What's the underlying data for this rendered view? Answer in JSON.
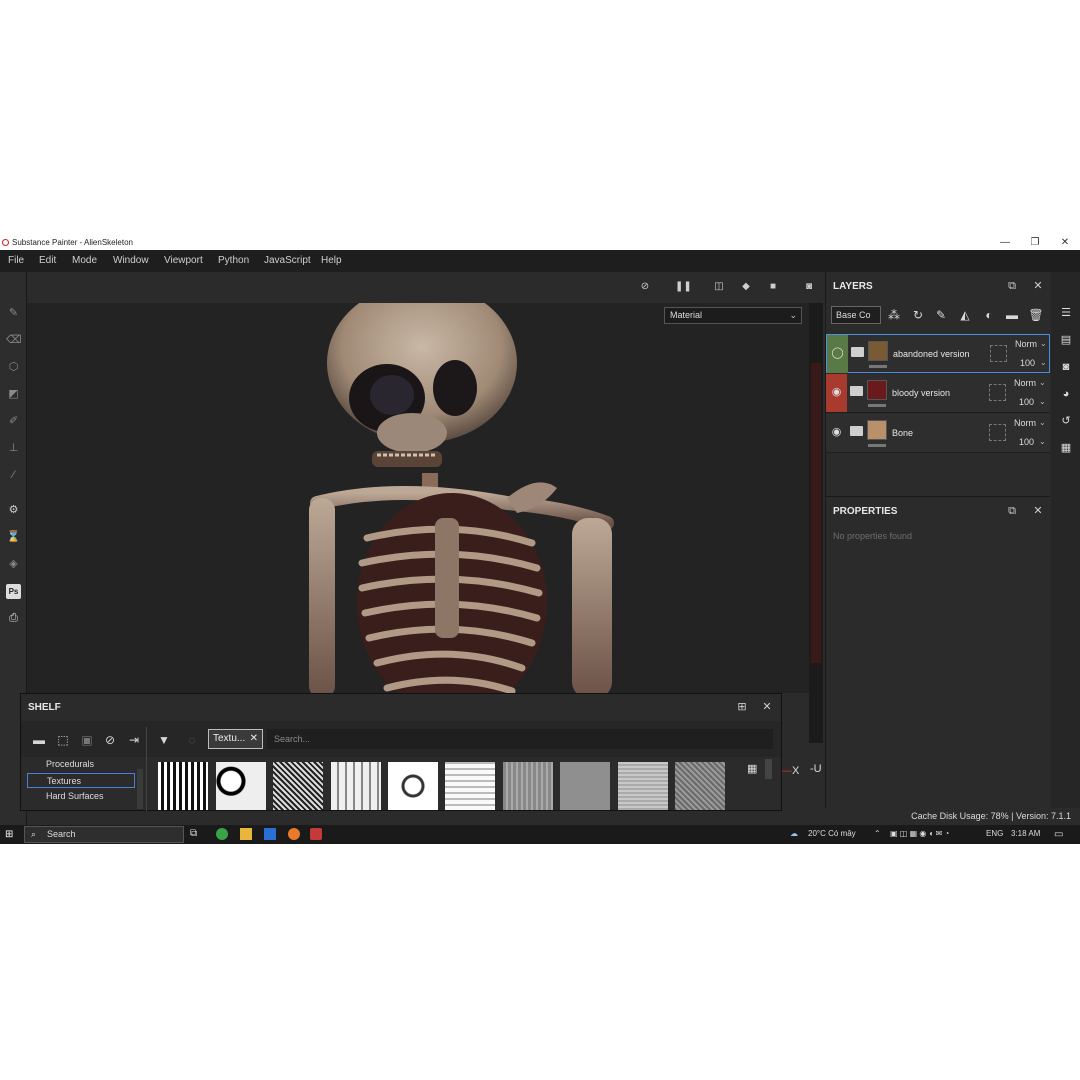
{
  "window": {
    "title": "Substance Painter - AlienSkeleton",
    "minimize": "—",
    "restore": "❐",
    "close": "✕"
  },
  "menu": [
    "File",
    "Edit",
    "Mode",
    "Window",
    "Viewport",
    "Python",
    "JavaScript",
    "Help"
  ],
  "viewport": {
    "mode_select": "Material",
    "axis_label": "-U",
    "axis_x": "X"
  },
  "layers": {
    "title": "LAYERS",
    "channel": "Base Co",
    "items": [
      {
        "name": "abandoned version",
        "blend": "Norm",
        "opacity": "100",
        "color": "#5a7a45",
        "thumb": "#7a5a35"
      },
      {
        "name": "bloody version",
        "blend": "Norm",
        "opacity": "100",
        "color": "#a93a2e",
        "thumb": "#6a1a1a"
      },
      {
        "name": "Bone",
        "blend": "Norm",
        "opacity": "100",
        "color": "#2e2e2e",
        "thumb": "#b8916a"
      }
    ]
  },
  "properties": {
    "title": "PROPERTIES",
    "empty": "No properties found"
  },
  "shelf": {
    "title": "SHELF",
    "tag": "Textu...",
    "search_placeholder": "Search...",
    "categories": [
      "Procedurals",
      "Textures",
      "Hard Surfaces"
    ],
    "selected_category": "Textures"
  },
  "status": {
    "text": "Cache Disk Usage: 78% | Version: 7.1.1"
  },
  "taskbar": {
    "search": "Search",
    "weather": "20°C  Có mây",
    "lang": "ENG",
    "time": "3:18 AM"
  }
}
